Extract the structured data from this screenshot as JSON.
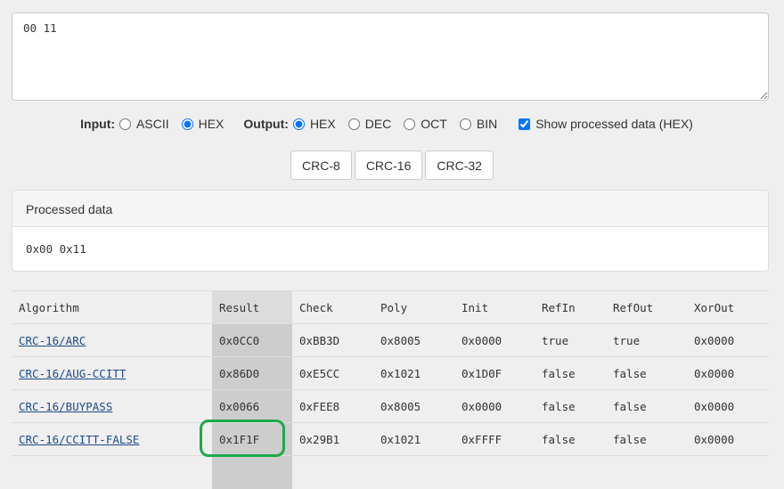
{
  "input_text": "00 11",
  "options": {
    "input_label": "Input:",
    "input_ascii": "ASCII",
    "input_hex": "HEX",
    "output_label": "Output:",
    "output_hex": "HEX",
    "output_dec": "DEC",
    "output_oct": "OCT",
    "output_bin": "BIN",
    "show_processed": "Show processed data (HEX)"
  },
  "buttons": {
    "crc8": "CRC-8",
    "crc16": "CRC-16",
    "crc32": "CRC-32"
  },
  "processed": {
    "title": "Processed data",
    "value": "0x00 0x11"
  },
  "table": {
    "headers": [
      "Algorithm",
      "Result",
      "Check",
      "Poly",
      "Init",
      "RefIn",
      "RefOut",
      "XorOut"
    ],
    "rows": [
      [
        "CRC-16/ARC",
        "0x0CC0",
        "0xBB3D",
        "0x8005",
        "0x0000",
        "true",
        "true",
        "0x0000"
      ],
      [
        "CRC-16/AUG-CCITT",
        "0x86D0",
        "0xE5CC",
        "0x1021",
        "0x1D0F",
        "false",
        "false",
        "0x0000"
      ],
      [
        "CRC-16/BUYPASS",
        "0x0066",
        "0xFEE8",
        "0x8005",
        "0x0000",
        "false",
        "false",
        "0x0000"
      ],
      [
        "CRC-16/CCITT-FALSE",
        "0x1F1F",
        "0x29B1",
        "0x1021",
        "0xFFFF",
        "false",
        "false",
        "0x0000"
      ]
    ]
  },
  "highlight_color": "#1fa84a"
}
